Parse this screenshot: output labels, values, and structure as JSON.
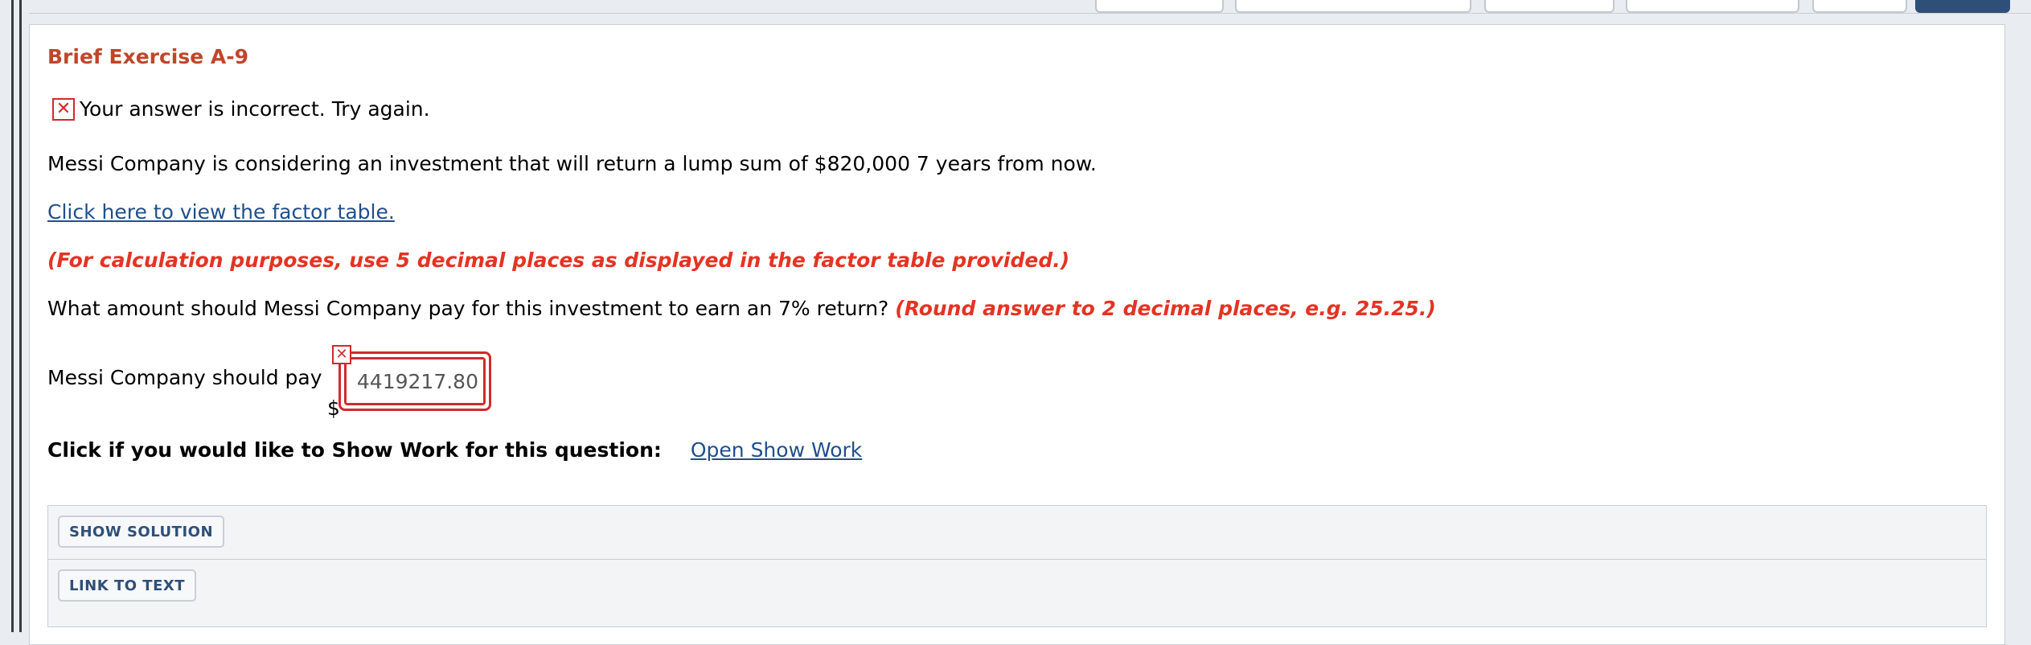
{
  "exercise": {
    "title": "Brief Exercise A-9"
  },
  "feedback": {
    "status_icon": "close-icon",
    "message": "Your answer is incorrect.  Try again."
  },
  "question": {
    "prompt": "Messi Company is considering an investment that will return a lump sum of $820,000 7 years from now.",
    "factor_link": "Click here to view the factor table.",
    "calc_note": "(For calculation purposes, use 5 decimal places as displayed in the factor table provided.)",
    "ask": "What amount should Messi Company pay for this investment to earn an 7% return?",
    "round_note": "(Round answer to 2 decimal places, e.g. 25.25.)"
  },
  "answer": {
    "label": "Messi Company should pay",
    "currency": "$",
    "value": "4419217.80"
  },
  "show_work": {
    "prompt": "Click if you would like to Show Work for this question:",
    "link": "Open Show Work"
  },
  "actions": {
    "show_solution": "SHOW SOLUTION",
    "link_to_text": "LINK TO TEXT"
  },
  "colors": {
    "title": "#c0462a",
    "error": "#e53323",
    "link": "#1f4f8c",
    "button_text": "#2e4f78"
  }
}
